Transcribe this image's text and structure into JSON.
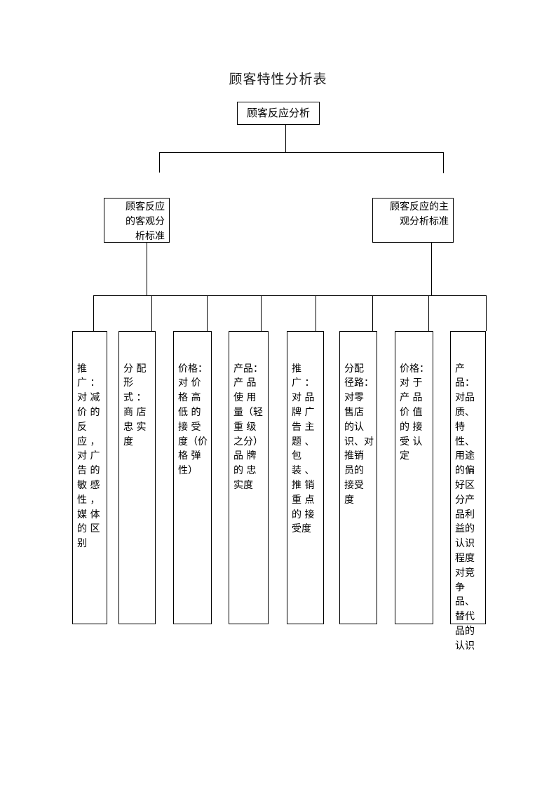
{
  "title": "顾客特性分析表",
  "root": {
    "label": "顾客反应分析"
  },
  "branches": [
    {
      "label": "顾客反应\n的客观分\n析标准"
    },
    {
      "label": "顾客反应的主\n观分析标准"
    }
  ],
  "leaves": [
    {
      "text": "推\n广 ：\n对 减\n价 的\n反\n应 ，\n对 广\n告 的\n敏 感\n性 ，\n媒 体\n的 区\n别"
    },
    {
      "text": "分 配\n形\n式 ：\n商 店\n忠 实\n度"
    },
    {
      "text": "价格：\n对 价\n格 高\n低 的\n接 受\n度（价\n格 弹\n性）"
    },
    {
      "text": "产品：\n产 品\n使 用\n量（轻\n重 级\n之分）\n品 牌\n的 忠\n实度"
    },
    {
      "text": "推\n广 ：\n对 品\n牌 广\n告 主\n题 、\n包\n装 、\n推 销\n重 点\n的 接\n受度"
    },
    {
      "text": "分配\n径路：\n对零\n售店\n的认\n识、对\n推销\n员的\n接受\n度"
    },
    {
      "text": "价格：\n对 于\n产 品\n价 值\n的 接\n受 认\n定"
    },
    {
      "text": "产\n品：\n对品\n质、\n特\n性、\n用途\n的偏\n好区\n分产\n品利\n益的\n认识\n程度\n对竞\n争\n品、\n替代\n品的\n认识"
    }
  ]
}
